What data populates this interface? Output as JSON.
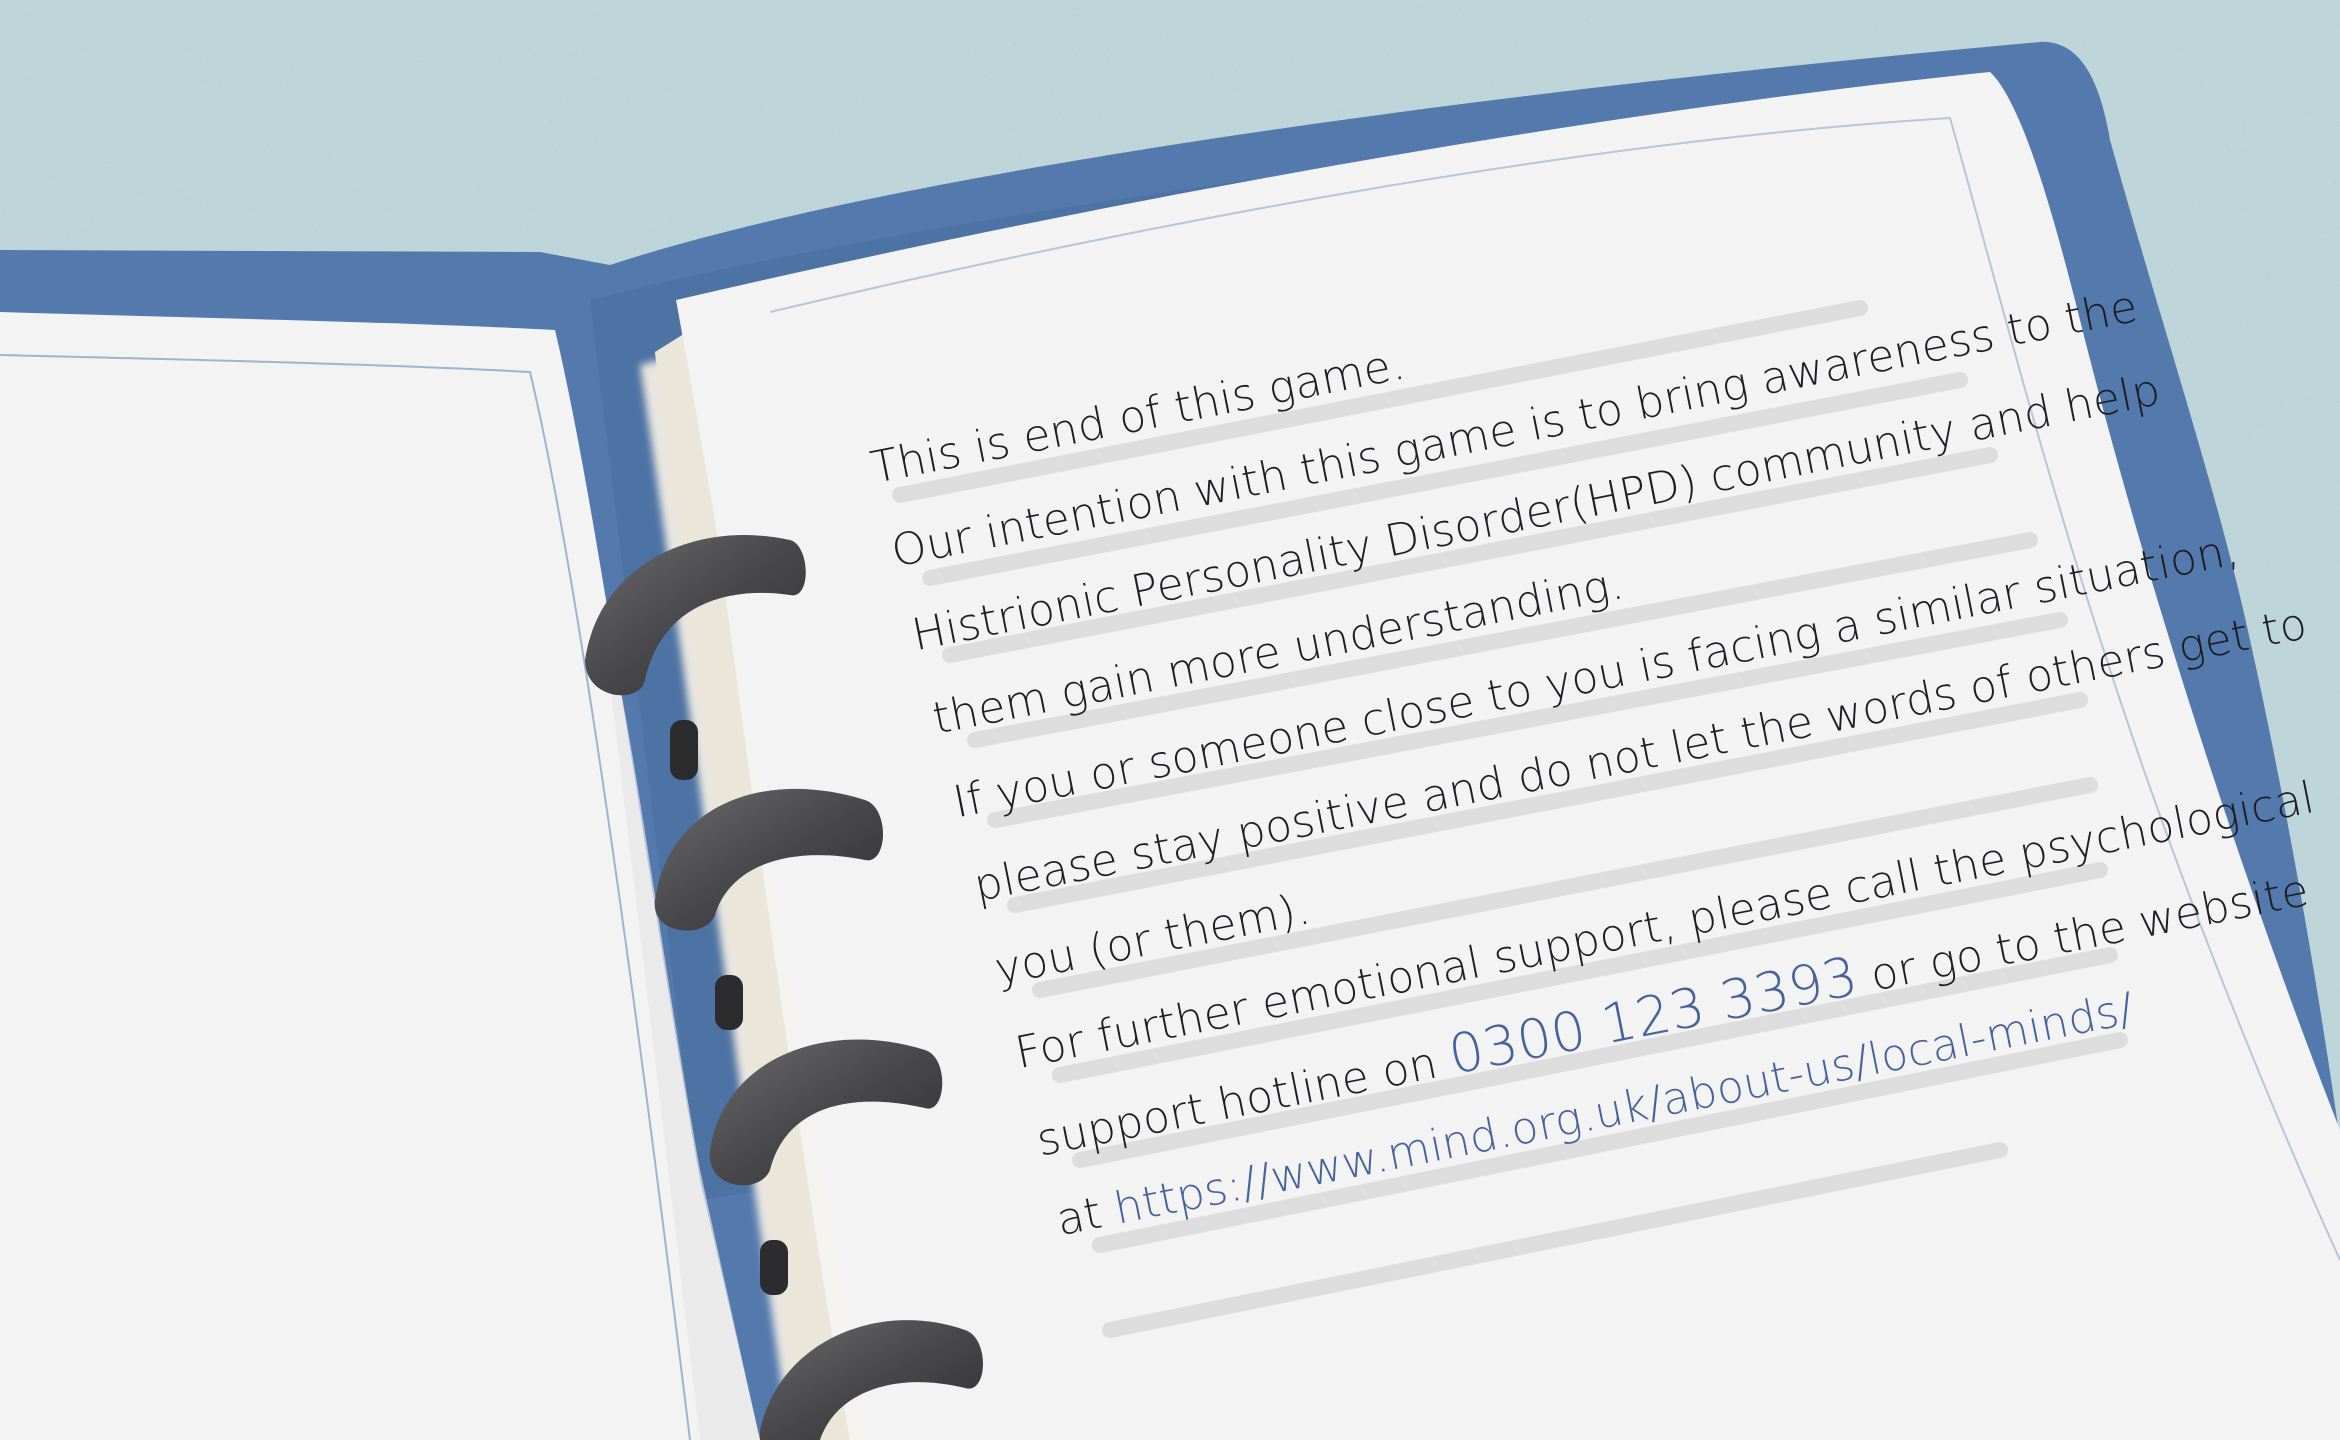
{
  "notebook": {
    "colors": {
      "background": "#bdd4d9",
      "cover": "#5379ad",
      "page": "#f3f3f3",
      "ink": "#1d1d22",
      "link": "#47629a",
      "ring": "#4a4a4c"
    },
    "message": {
      "line1": "This is end of this game.",
      "line2": "Our intention with this game is to bring awareness to the",
      "line3": "Histrionic Personality Disorder(HPD) community and help",
      "line4": "them gain more understanding.",
      "line5": "If you or someone close to you is facing a similar situation,",
      "line6": "please stay positive and do not let the words of others get to",
      "line7": "you (or them).",
      "line8": "For further emotional support, please call the psychological",
      "line9_prefix": "support hotline on",
      "phone": "0300 123 3393",
      "line9_suffix": "or go to the website",
      "line10_prefix": "at",
      "url": "https://www.mind.org.uk/about-us/local-minds/"
    }
  }
}
